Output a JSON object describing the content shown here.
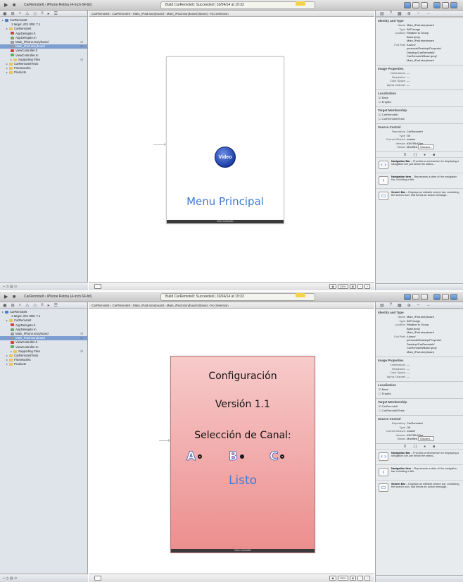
{
  "toolbar": {
    "scheme": "CarRemoteIt",
    "destination": "iPhone Retina (4-inch 64-bit)",
    "status": "Build CarRemoteIt: Succeeded | 10/04/14 at 19:33",
    "warning_count": "1"
  },
  "navigator": {
    "items": [
      {
        "label": "CarRemoteIt",
        "level": 0,
        "icon": "project"
      },
      {
        "label": "1 target, iOS SDK 7.1",
        "level": 1,
        "icon": "none"
      },
      {
        "label": "CarRemoteIt",
        "level": 1,
        "icon": "folder"
      },
      {
        "label": "AppDelegate.h",
        "level": 2,
        "icon": "h-file"
      },
      {
        "label": "AppDelegate.m",
        "level": 2,
        "icon": "m-file"
      },
      {
        "label": "Main_iPhone.storyboard",
        "level": 2,
        "icon": "storyboard",
        "mark": "M"
      },
      {
        "label": "Main_iPad.storyboard",
        "level": 2,
        "icon": "storyboard",
        "selected": true,
        "mark": "M"
      },
      {
        "label": "ViewController.h",
        "level": 2,
        "icon": "h-file"
      },
      {
        "label": "ViewController.m",
        "level": 2,
        "icon": "m-file"
      },
      {
        "label": "Supporting Files",
        "level": 2,
        "icon": "folder",
        "mark": "M"
      },
      {
        "label": "CarRemoteItTests",
        "level": 1,
        "icon": "folder"
      },
      {
        "label": "Frameworks",
        "level": 1,
        "icon": "folder"
      },
      {
        "label": "Products",
        "level": 1,
        "icon": "folder"
      }
    ]
  },
  "jumpbar": {
    "path": "CarRemoteIt  ›  CarRemoteIt  ›  Main_iPad.storyboard  ›  Main_iPad.storyboard (Base)  ›  No Selection"
  },
  "screen1": {
    "video_button": "Video",
    "title": "Menu Principal",
    "scene_bar": "View Controller"
  },
  "screen2": {
    "config_title": "Configuración",
    "version": "Versión 1.1",
    "channel_title": "Selección de Canal:",
    "channel_a": "A",
    "channel_b": "B",
    "channel_c": "C",
    "done": "Listo",
    "scene_bar": "View Controller"
  },
  "zoom": {
    "label": "100%"
  },
  "inspector": {
    "identity_title": "Identity and Type",
    "name_key": "Name",
    "name_val": "Main_iPad.storyboard",
    "type_key": "Type",
    "type_val": "IMP image",
    "location_key": "Location",
    "location_val": "Relative to Group",
    "location_path1": "Base.lproj/",
    "location_path2": "Main_iPad.storyboard",
    "fullpath_key": "Full Path",
    "fullpath_val": "/Users/",
    "fullpath_l2": "personal/Desktop/Proyecto/",
    "fullpath_l3": "Desktop/CarRemoteIt/",
    "fullpath_l4": "CarRemoteIt/Base.lproj/",
    "fullpath_l5": "Main_iPad.storyboard",
    "image_title": "Image Properties",
    "dimensions": "Dimensions",
    "resolution": "Resolution",
    "color_space": "Color Space",
    "alpha": "Alpha Channel",
    "dash": "—",
    "localization_title": "Localization",
    "loc_base": "Base",
    "loc_english": "English",
    "target_title": "Target Membership",
    "target1": "CarRemoteIt",
    "target2": "CarRemoteItTests",
    "source_title": "Source Control",
    "repo_key": "Repository",
    "repo_val": "CarRemoteIt",
    "typesc_key": "Type",
    "typesc_val": "Git",
    "branch_key": "Current Branch",
    "branch_val": "master",
    "version_key": "Version",
    "version_val": "It3b7f3b42ee",
    "status_key": "Status",
    "status_val": "Modified",
    "discard": "Discard...",
    "lib_tabs": [
      "D",
      "{ }",
      "●",
      "■"
    ],
    "library": [
      {
        "icon": "‹ ›",
        "title": "Navigation Bar",
        "desc": "– Provides a mechanism for displaying a navigation bar just below the status..."
      },
      {
        "icon": "‹",
        "title": "Navigation Item",
        "desc": "– Represents a state of the navigation bar, including a title."
      },
      {
        "icon": "▭",
        "title": "Search Bar",
        "desc": "– Displays an editable search bar, containing the search icon, that sends an action message..."
      }
    ]
  }
}
